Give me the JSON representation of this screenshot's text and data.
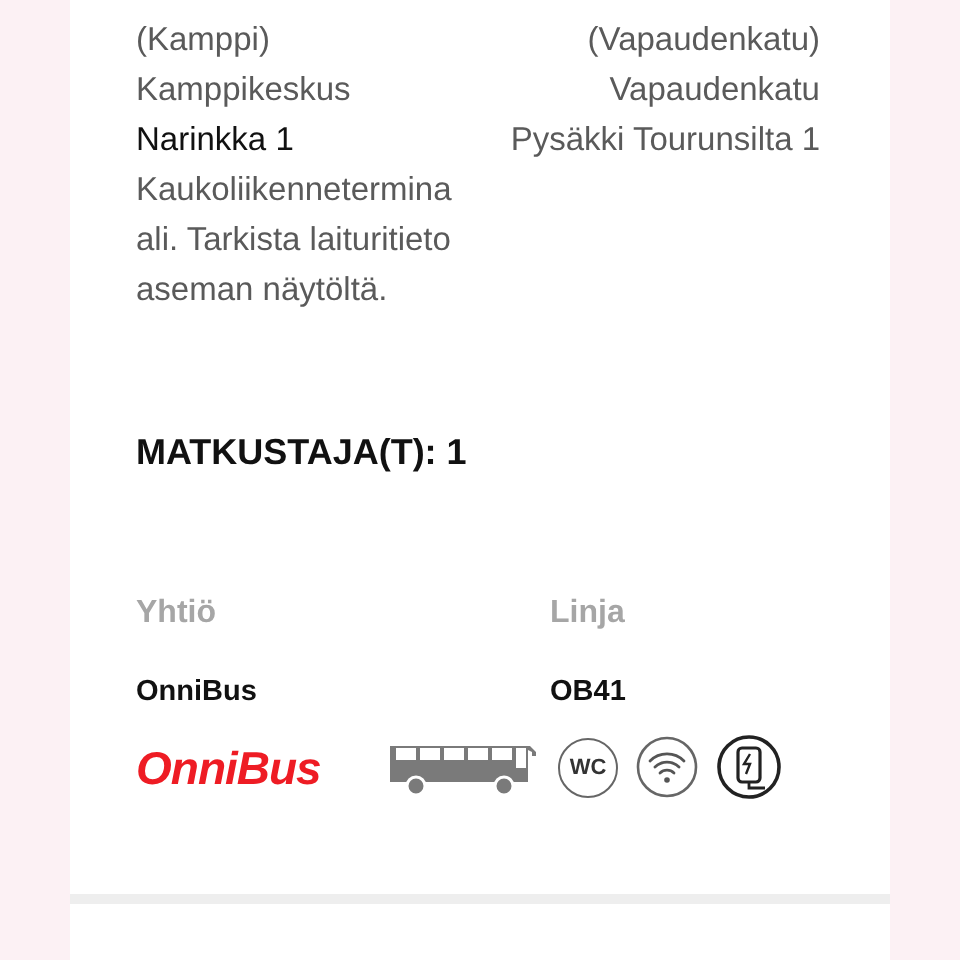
{
  "route": {
    "from_lines": [
      {
        "text": "(Kamppi)",
        "strong": false
      },
      {
        "text": "Kamppikeskus",
        "strong": false
      },
      {
        "text": "Narinkka 1",
        "strong": true
      },
      {
        "text": "Kaukoliikenneterminaali. Tarkista laituritieto aseman näytöltä.",
        "strong": false
      }
    ],
    "to_lines": [
      {
        "text": "(Vapaudenkatu)",
        "strong": false
      },
      {
        "text": "Vapaudenkatu",
        "strong": false
      },
      {
        "text": "Pysäkki Tourunsilta 1",
        "strong": false
      }
    ]
  },
  "passengers": "MATKUSTAJA(T): 1",
  "operator": {
    "company_label": "Yhtiö",
    "line_label": "Linja",
    "company": "OnniBus",
    "line": "OB41",
    "logo_text": "OnniBus",
    "amenities": [
      {
        "kind": "bus"
      },
      {
        "kind": "wc",
        "label": "WC"
      },
      {
        "kind": "wifi"
      },
      {
        "kind": "charging"
      }
    ]
  }
}
